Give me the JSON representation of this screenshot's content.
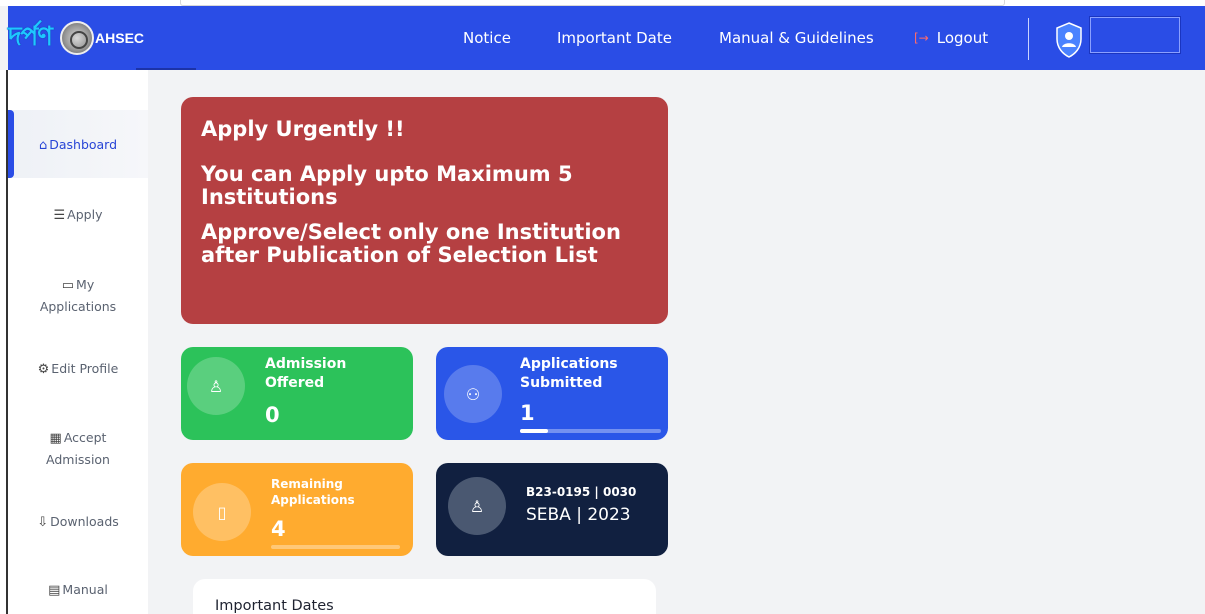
{
  "header": {
    "logo_text": "দৰ্পণ",
    "org": "AHSEC",
    "nav": {
      "notice": "Notice",
      "important_date": "Important Date",
      "manual": "Manual & Guidelines",
      "logout": "Logout"
    },
    "colors": {
      "bar": "#2a4de6"
    }
  },
  "sidebar": {
    "items": [
      {
        "label": "Dashboard",
        "icon": "home-icon",
        "active": true
      },
      {
        "label": "Apply",
        "icon": "list-icon"
      },
      {
        "label": "My Applications",
        "icon": "folder-icon"
      },
      {
        "label": "Edit Profile",
        "icon": "settings-icon"
      },
      {
        "label": "Accept Admission",
        "icon": "building-icon"
      },
      {
        "label": "Downloads",
        "icon": "download-icon"
      },
      {
        "label": "Manual",
        "icon": "book-icon"
      }
    ]
  },
  "alert": {
    "line1": "Apply Urgently !!",
    "line2": "You can Apply upto Maximum 5 Institutions",
    "line3": "Approve/Select only one Institution after Publication of Selection List",
    "color": "#b54042"
  },
  "stats": {
    "admission_offered": {
      "title": "Admission Offered",
      "value": "0",
      "color": "#2cc25a",
      "icon": "user-icon"
    },
    "applications_submitted": {
      "title": "Applications Submitted",
      "value": "1",
      "progress": 0.2,
      "color": "#2a56e8",
      "icon": "group-icon"
    },
    "remaining_applications": {
      "title": "Remaining Applications",
      "value": "4",
      "progress": 0.0,
      "color": "#ffab2f",
      "icon": "book-open-icon"
    },
    "profile": {
      "code": "B23-0195 | 0030",
      "board": "SEBA | 2023",
      "color": "#112040",
      "icon": "user-icon"
    }
  },
  "important_dates": {
    "heading": "Important Dates"
  }
}
